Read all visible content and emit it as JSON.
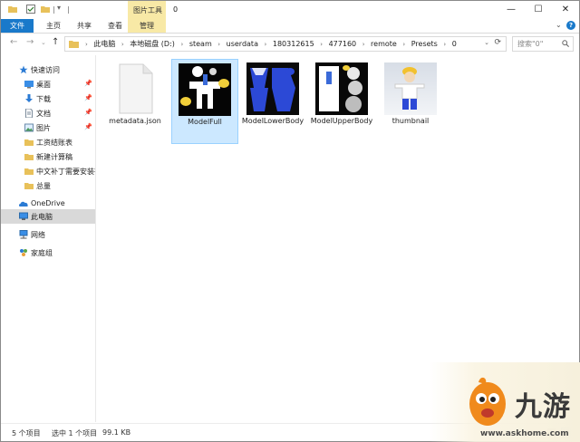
{
  "titlebar": {
    "context_tab_header": "图片工具",
    "title": "0",
    "minimize_symbol": "—",
    "maximize_symbol": "☐",
    "close_symbol": "✕",
    "quick_access_separator": "|",
    "quick_access_dropdown": "▾"
  },
  "ribbon": {
    "tabs": [
      "文件",
      "主页",
      "共享",
      "查看",
      "管理"
    ],
    "expand_symbol": "⌄",
    "help_symbol": "?"
  },
  "navigation": {
    "back_symbol": "←",
    "forward_symbol": "→",
    "recent_symbol": "⌄",
    "up_symbol": "↑",
    "breadcrumb_separator": "›",
    "breadcrumbs": [
      "此电脑",
      "本地磁盘 (D:)",
      "steam",
      "userdata",
      "180312615",
      "477160",
      "remote",
      "Presets",
      "0"
    ],
    "address_dropdown": "⌄",
    "refresh_symbol": "⟳",
    "search_placeholder": "搜索\"0\""
  },
  "sidebar": {
    "pin_symbol": "📌",
    "items": [
      {
        "label": "快速访问",
        "icon": "star-icon"
      },
      {
        "label": "桌面",
        "icon": "desktop-icon",
        "pinned": true
      },
      {
        "label": "下载",
        "icon": "download-icon",
        "pinned": true
      },
      {
        "label": "文档",
        "icon": "document-icon",
        "pinned": true
      },
      {
        "label": "图片",
        "icon": "pictures-icon",
        "pinned": true
      },
      {
        "label": "工资结账表",
        "icon": "folder-icon"
      },
      {
        "label": "新建计算稿",
        "icon": "folder-icon"
      },
      {
        "label": "中文补丁需要安装在",
        "icon": "folder-icon"
      },
      {
        "label": "总量",
        "icon": "folder-icon"
      },
      {
        "label": "OneDrive",
        "icon": "onedrive-icon"
      },
      {
        "label": "此电脑",
        "icon": "computer-icon",
        "selected": true
      },
      {
        "label": "网络",
        "icon": "network-icon"
      },
      {
        "label": "家庭组",
        "icon": "homegroup-icon"
      }
    ]
  },
  "files": [
    {
      "name": "metadata.json",
      "type": "json"
    },
    {
      "name": "ModelFull",
      "type": "image",
      "selected": true
    },
    {
      "name": "ModelLowerBody",
      "type": "image"
    },
    {
      "name": "ModelUpperBody",
      "type": "image"
    },
    {
      "name": "thumbnail",
      "type": "image"
    }
  ],
  "status": {
    "item_count": "5 个项目",
    "selected": "选中 1 个项目",
    "size": "99.1 KB"
  },
  "watermark": {
    "brand": "九游",
    "url": "www.askhome.com"
  },
  "colors": {
    "file_tab": "#1979ca",
    "context_tab": "#f8e9a6",
    "selection": "#cce8ff",
    "sidebar_selection": "#d9d9d9",
    "folder": "#e8c15a"
  }
}
